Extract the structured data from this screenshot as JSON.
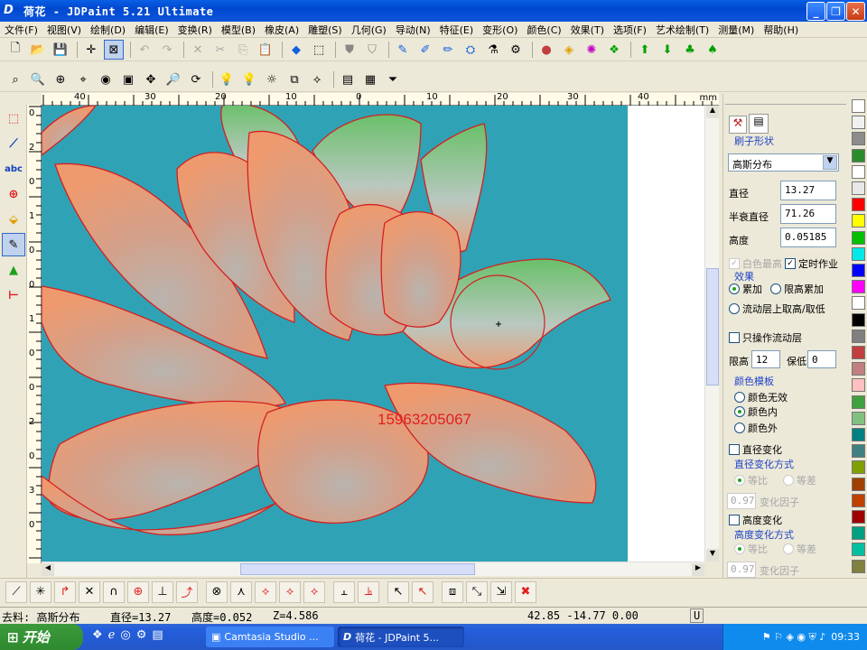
{
  "window": {
    "title": "荷花 - JDPaint 5.21 Ultimate",
    "logo": "D"
  },
  "menu": [
    "文件(F)",
    "视图(V)",
    "绘制(D)",
    "编辑(E)",
    "变换(R)",
    "模型(B)",
    "橡皮(A)",
    "雕塑(S)",
    "几何(G)",
    "导动(N)",
    "特征(E)",
    "变形(O)",
    "颜色(C)",
    "效果(T)",
    "选项(F)",
    "艺术绘制(T)",
    "测量(M)",
    "帮助(H)"
  ],
  "ruler": {
    "unit": "mm",
    "h_ticks": [
      "40",
      "30",
      "20",
      "10",
      "0",
      "10",
      "20",
      "30",
      "40"
    ],
    "v_ticks": [
      "0",
      "2",
      "0",
      "1",
      "0",
      "0",
      "1",
      "0",
      "0",
      "2",
      "0",
      "3",
      "0"
    ]
  },
  "canvas": {
    "watermark": "15963205067",
    "bg": "#2fa3b5",
    "petal_fill": "#e8a07a",
    "outline": "#e02020"
  },
  "panel": {
    "section_title": "刷子形状",
    "brush_shape": "高斯分布",
    "diameter_label": "直径",
    "diameter": "13.27",
    "halfdecay_label": "半衰直径",
    "halfdecay": "71.26",
    "height_label": "高度",
    "height": "0.05185",
    "white_top": "白色最高",
    "timed": "定时作业",
    "effect_group": "效果",
    "effect_add": "累加",
    "effect_limit": "限高累加",
    "effect_flow": "流动层上取高/取低",
    "only_flow": "只操作流动层",
    "limit_high_label": "限高",
    "limit_high": "12",
    "keep_low_label": "保低",
    "keep_low": "0",
    "color_template": "颜色模板",
    "color_none": "颜色无效",
    "color_in": "颜色内",
    "color_out": "颜色外",
    "dia_change": "直径变化",
    "dia_change_mode": "直径变化方式",
    "equal_ratio": "等比",
    "equal_diff": "等差",
    "factor_value": "0.97",
    "factor_label": "变化因子",
    "height_change": "高度变化",
    "height_change_mode": "高度变化方式",
    "equal_ratio2": "等比",
    "equal_diff2": "等差",
    "factor_value2": "0.97",
    "factor_label2": "变化因子"
  },
  "palette": [
    "#ffffff",
    "#f0f0f0",
    "#8c8c8c",
    "#2c8c2c",
    "#ffffff",
    "#e8e8e8",
    "#ff0000",
    "#ffff00",
    "#00c000",
    "#00e8e8",
    "#0000ff",
    "#ff00ff",
    "#ffffff",
    "#000000",
    "#808080",
    "#c04040",
    "#c08080",
    "#ffc0c0",
    "#40a040",
    "#80c080",
    "#008080",
    "#408080",
    "#80a000",
    "#a04000",
    "#c04000",
    "#a00000",
    "#00a080",
    "#00c0a0",
    "#808040"
  ],
  "status": {
    "mode": "去料: 高斯分布",
    "diameter": "直径=13.27",
    "height": "高度=0.052",
    "z": "Z=4.586",
    "coords": "42.85 -14.77 0.00",
    "u": "U"
  },
  "taskbar": {
    "start": "开始",
    "task1": "Camtasia Studio ...",
    "task2": "荷花 - JDPaint 5...",
    "time": "09:33"
  }
}
